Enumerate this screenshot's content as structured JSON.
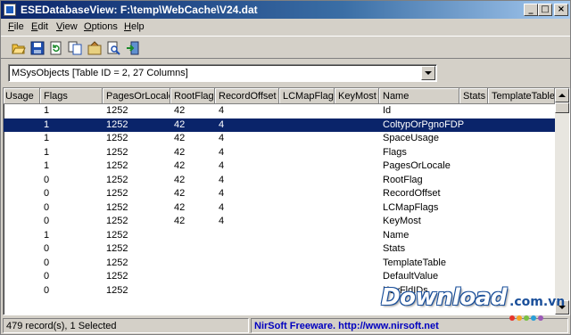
{
  "window": {
    "title": "ESEDatabaseView:  F:\\temp\\WebCache\\V24.dat",
    "minimize": "_",
    "maximize": "□",
    "close": "×"
  },
  "menu": [
    "File",
    "Edit",
    "View",
    "Options",
    "Help"
  ],
  "toolbar_icons": [
    "open-folder-icon",
    "save-icon",
    "refresh-icon",
    "copy-icon",
    "properties-icon",
    "find-icon",
    "exit-icon"
  ],
  "table_selector": {
    "selected": "MSysObjects   [Table ID = 2, 27 Columns]"
  },
  "columns": [
    "Usage",
    "Flags",
    "PagesOrLocale",
    "RootFlag",
    "RecordOffset",
    "LCMapFlags",
    "KeyMost",
    "Name",
    "Stats",
    "TemplateTable"
  ],
  "rows": [
    {
      "flags": "1",
      "pages": "1252",
      "root": "42",
      "offset": "4",
      "lcmap": "",
      "keymost": "",
      "name": "Id",
      "selected": false
    },
    {
      "flags": "1",
      "pages": "1252",
      "root": "42",
      "offset": "4",
      "lcmap": "",
      "keymost": "",
      "name": "ColtypOrPgnoFDP",
      "selected": true
    },
    {
      "flags": "1",
      "pages": "1252",
      "root": "42",
      "offset": "4",
      "lcmap": "",
      "keymost": "",
      "name": "SpaceUsage",
      "selected": false
    },
    {
      "flags": "1",
      "pages": "1252",
      "root": "42",
      "offset": "4",
      "lcmap": "",
      "keymost": "",
      "name": "Flags",
      "selected": false
    },
    {
      "flags": "1",
      "pages": "1252",
      "root": "42",
      "offset": "4",
      "lcmap": "",
      "keymost": "",
      "name": "PagesOrLocale",
      "selected": false
    },
    {
      "flags": "0",
      "pages": "1252",
      "root": "42",
      "offset": "4",
      "lcmap": "",
      "keymost": "",
      "name": "RootFlag",
      "selected": false
    },
    {
      "flags": "0",
      "pages": "1252",
      "root": "42",
      "offset": "4",
      "lcmap": "",
      "keymost": "",
      "name": "RecordOffset",
      "selected": false
    },
    {
      "flags": "0",
      "pages": "1252",
      "root": "42",
      "offset": "4",
      "lcmap": "",
      "keymost": "",
      "name": "LCMapFlags",
      "selected": false
    },
    {
      "flags": "0",
      "pages": "1252",
      "root": "42",
      "offset": "4",
      "lcmap": "",
      "keymost": "",
      "name": "KeyMost",
      "selected": false
    },
    {
      "flags": "1",
      "pages": "1252",
      "root": "",
      "offset": "",
      "lcmap": "",
      "keymost": "",
      "name": "Name",
      "selected": false
    },
    {
      "flags": "0",
      "pages": "1252",
      "root": "",
      "offset": "",
      "lcmap": "",
      "keymost": "",
      "name": "Stats",
      "selected": false
    },
    {
      "flags": "0",
      "pages": "1252",
      "root": "",
      "offset": "",
      "lcmap": "",
      "keymost": "",
      "name": "TemplateTable",
      "selected": false
    },
    {
      "flags": "0",
      "pages": "1252",
      "root": "",
      "offset": "",
      "lcmap": "",
      "keymost": "",
      "name": "DefaultValue",
      "selected": false
    },
    {
      "flags": "0",
      "pages": "1252",
      "root": "",
      "offset": "",
      "lcmap": "",
      "keymost": "",
      "name": "KeyFldIDs",
      "selected": false
    }
  ],
  "status": {
    "records": "479 record(s), 1 Selected",
    "link": "NirSoft Freeware.  http://www.nirsoft.net"
  },
  "watermark": {
    "text": "Download",
    "suffix": ".com.vn",
    "dot_colors": [
      "#e8352b",
      "#f5a623",
      "#7ac143",
      "#2a9fd8",
      "#9b59b6"
    ]
  },
  "colors": {
    "selection": "#0a246a",
    "title_start": "#0a246a",
    "link": "#0000c0"
  }
}
